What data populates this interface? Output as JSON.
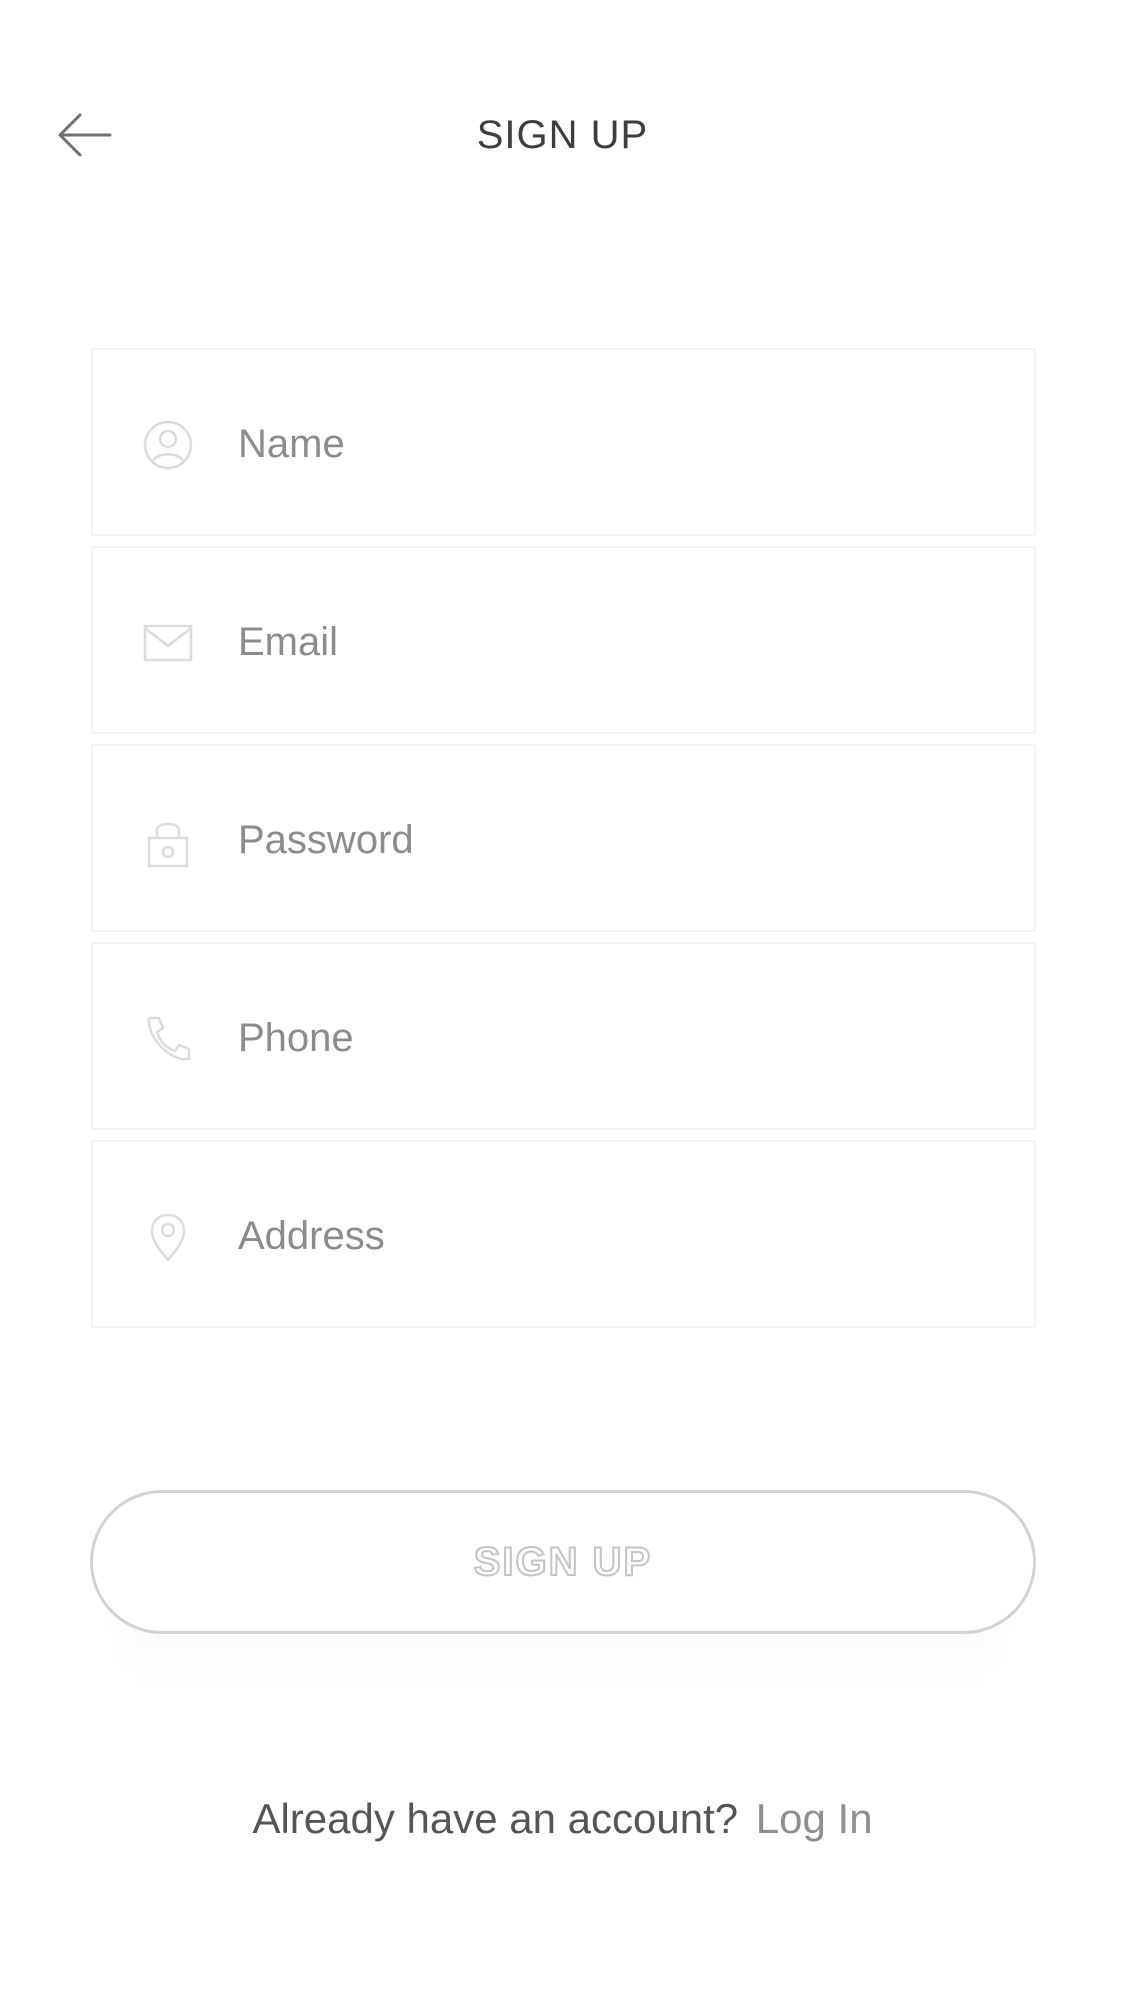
{
  "header": {
    "title": "SIGN UP",
    "back_icon": "arrow-left-icon"
  },
  "form": {
    "fields": [
      {
        "placeholder": "Name",
        "icon": "user-icon"
      },
      {
        "placeholder": "Email",
        "icon": "mail-icon"
      },
      {
        "placeholder": "Password",
        "icon": "lock-icon"
      },
      {
        "placeholder": "Phone",
        "icon": "phone-icon"
      },
      {
        "placeholder": "Address",
        "icon": "location-pin-icon"
      }
    ]
  },
  "signup_button": {
    "label": "SIGN UP"
  },
  "footer": {
    "prompt": "Already have an account?",
    "login_label": "Log In"
  },
  "colors": {
    "text": "#444444",
    "placeholder": "#8c8c8c",
    "icon": "#d9d9d9",
    "border": "#f4f4f4",
    "button_border": "#d3d3d3"
  }
}
